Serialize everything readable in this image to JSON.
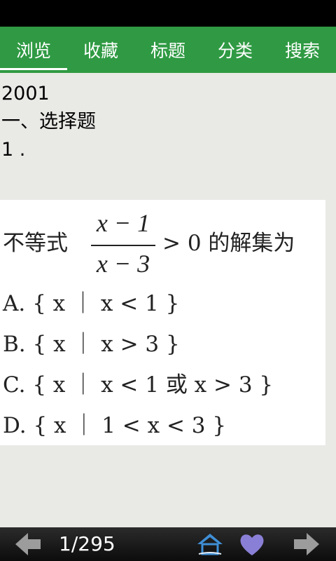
{
  "tabs": [
    {
      "label": "浏览",
      "active": true
    },
    {
      "label": "收藏",
      "active": false
    },
    {
      "label": "标题",
      "active": false
    },
    {
      "label": "分类",
      "active": false
    },
    {
      "label": "搜索",
      "active": false
    }
  ],
  "content": {
    "year": "2001",
    "section": "一、选择题",
    "number": "1 ."
  },
  "question": {
    "stem_prefix": "不等式",
    "numerator": "x − 1",
    "denominator": "x − 3",
    "stem_suffix": "> 0 的解集为",
    "options": [
      "A. { x ｜ x < 1 }",
      "B. { x ｜ x > 3 }",
      "C. { x ｜ x < 1 或 x > 3 }",
      "D. { x ｜ 1 < x < 3 }"
    ]
  },
  "footer": {
    "page_counter": "1/295"
  },
  "colors": {
    "tab_bar": "#2f9a43",
    "background": "#e9e9e6",
    "heart": "#8a7fd6"
  }
}
